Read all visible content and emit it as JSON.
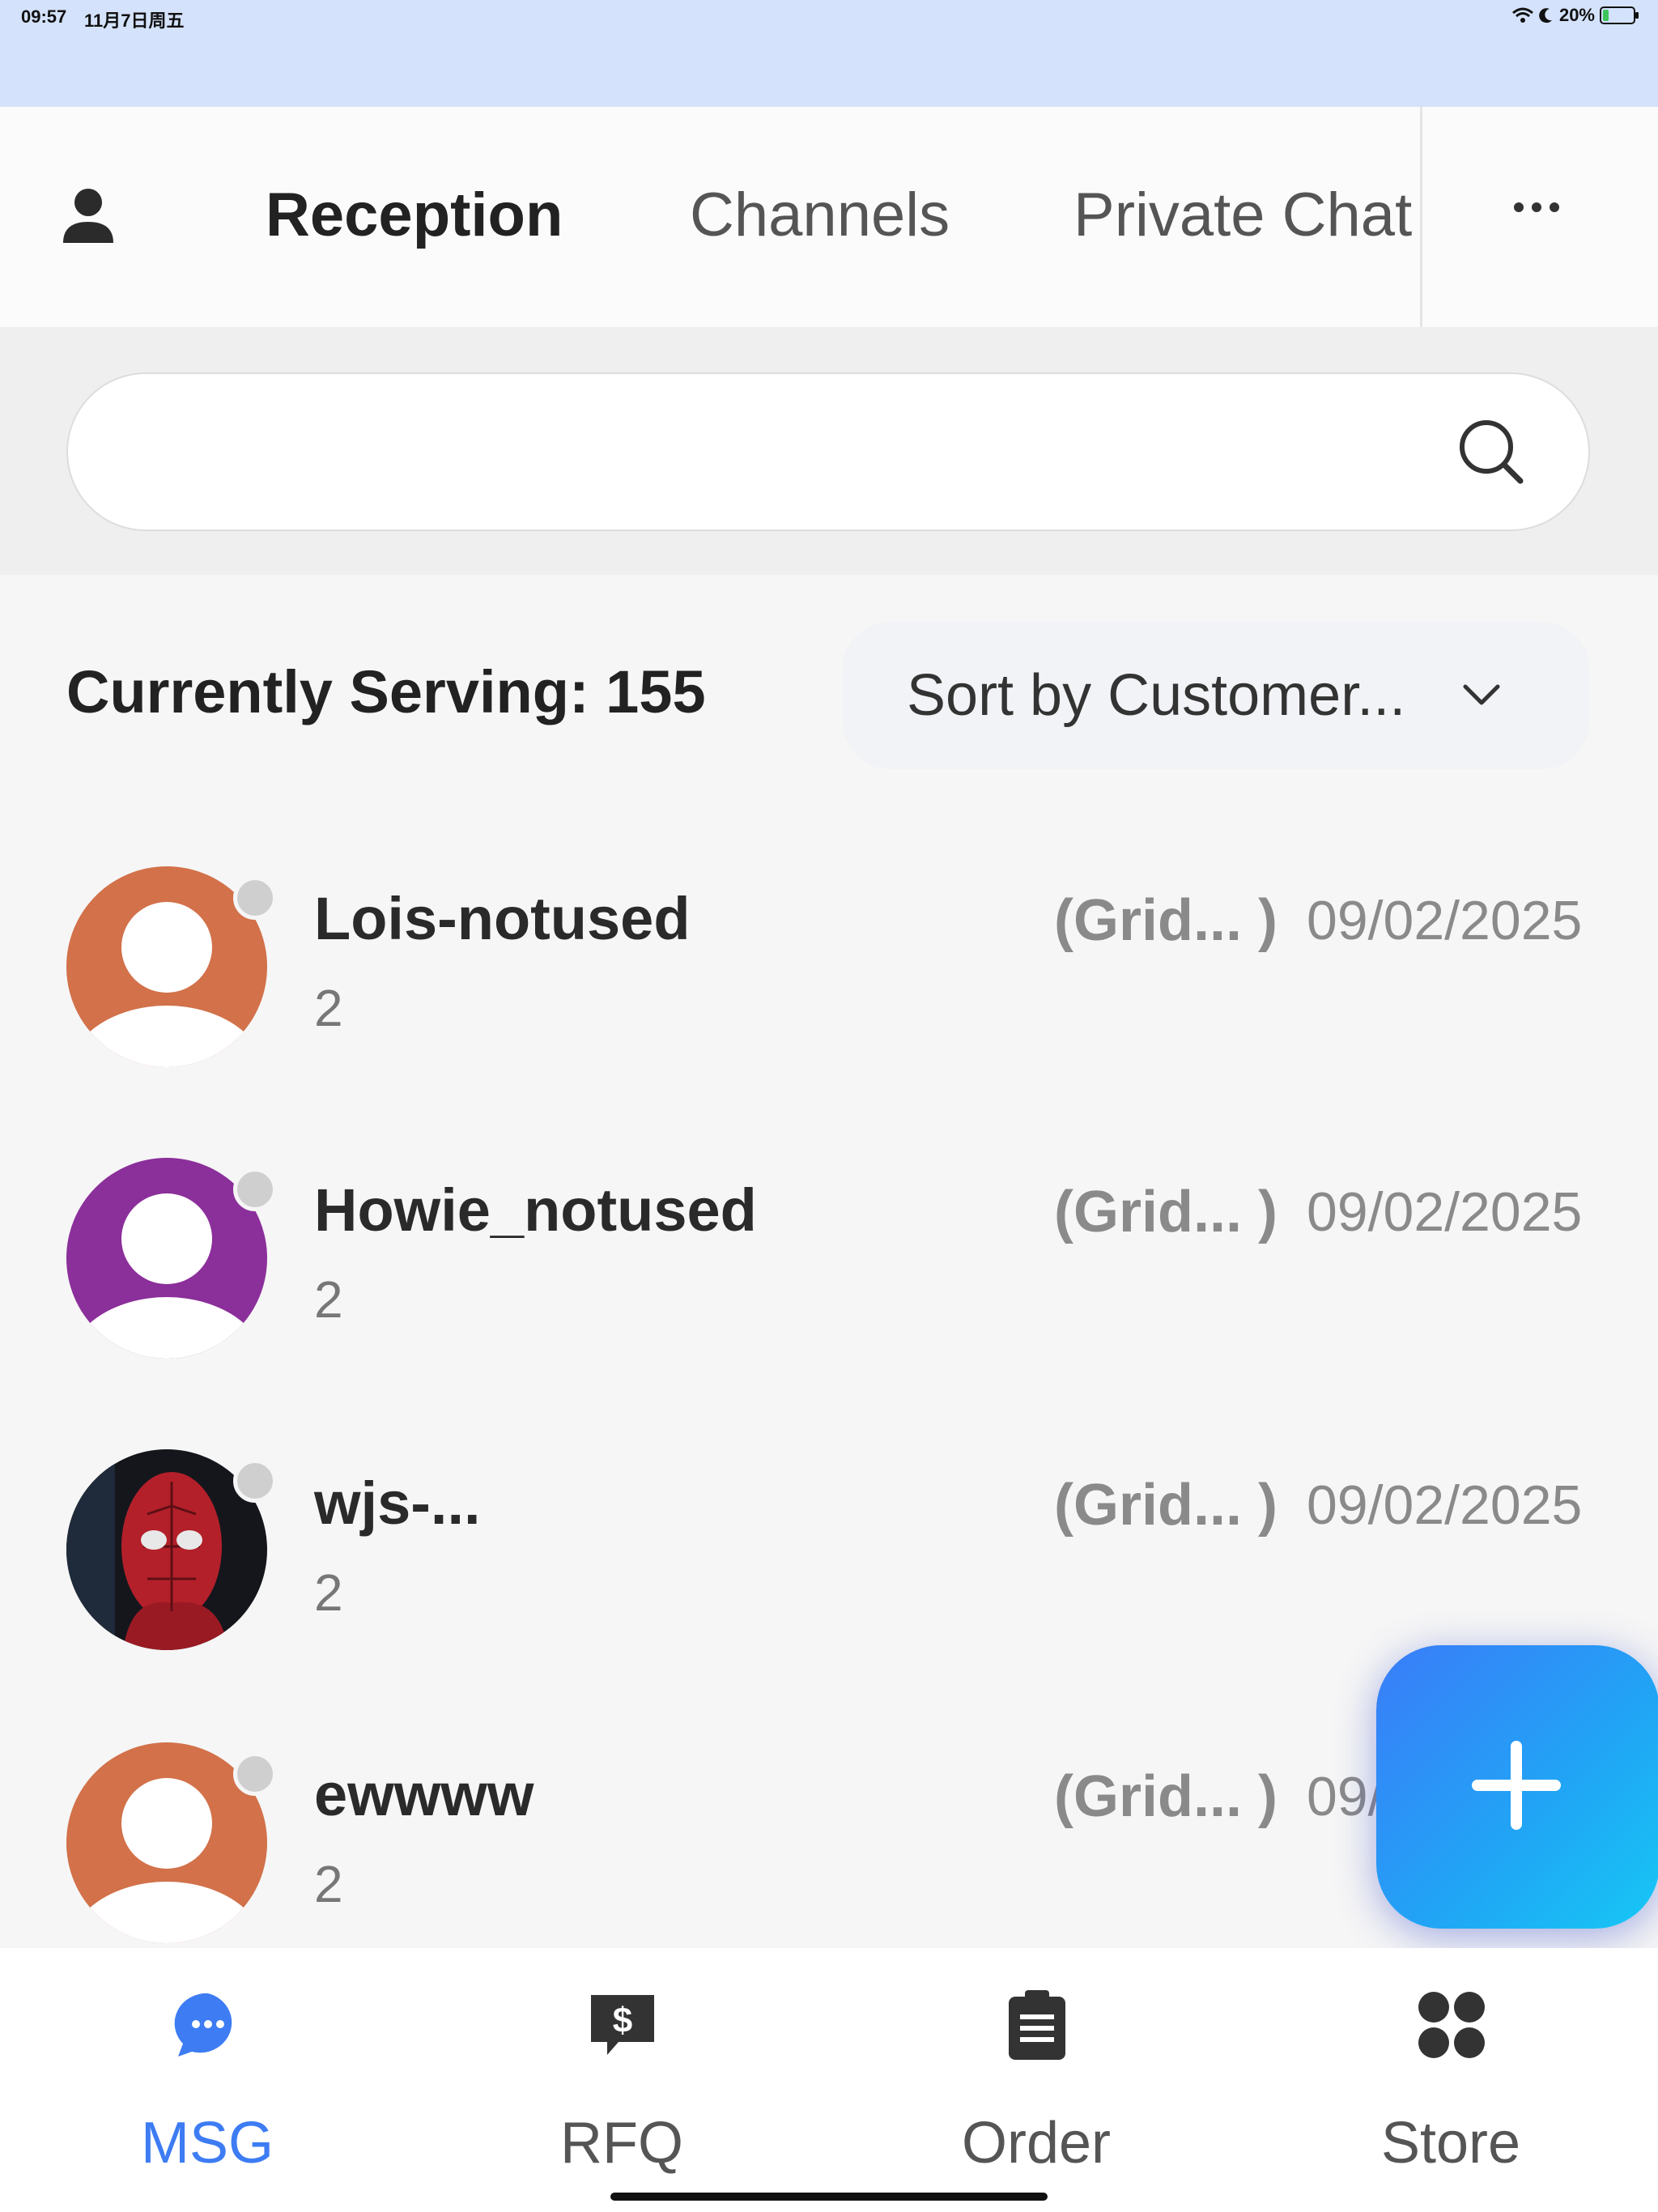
{
  "status_bar": {
    "time": "09:57",
    "date": "11月7日周五",
    "battery_text": "20%",
    "battery_level": 0.2,
    "icons": [
      "wifi-icon",
      "moon-icon",
      "battery-icon"
    ]
  },
  "top_nav": {
    "profile_icon": "person-icon",
    "tabs": [
      {
        "label": "Reception",
        "active": true
      },
      {
        "label": "Channels",
        "active": false
      },
      {
        "label": "Private Chat",
        "active": false
      }
    ],
    "more_icon": "more-dots-icon"
  },
  "search": {
    "value": "",
    "placeholder": "",
    "icon": "search-icon"
  },
  "queue": {
    "serving_text": "Currently Serving: 155",
    "sort_label": "Sort by Customer...",
    "sort_icon": "chevron-down-icon"
  },
  "conversations": [
    {
      "name": "Lois-notused",
      "count": "2",
      "group": "(Grid... )",
      "date": "09/02/2025",
      "avatar_color": "#d2714a",
      "avatar_type": "default",
      "status": "offline"
    },
    {
      "name": "Howie_notused",
      "count": "2",
      "group": "(Grid... )",
      "date": "09/02/2025",
      "avatar_color": "#8b2f9a",
      "avatar_type": "default",
      "status": "offline"
    },
    {
      "name": "wjs-...",
      "count": "2",
      "group": "(Grid... )",
      "date": "09/02/2025",
      "avatar_color": "#1a1a1a",
      "avatar_type": "photo",
      "status": "offline"
    },
    {
      "name": "ewwww",
      "count": "2",
      "group": "(Grid... )",
      "date": "09/",
      "avatar_color": "#d2714a",
      "avatar_type": "default",
      "status": "offline"
    }
  ],
  "fab": {
    "icon": "plus-icon",
    "colors": [
      "#3a7cf8",
      "#16c8f5"
    ]
  },
  "bottom_nav": [
    {
      "label": "MSG",
      "icon": "chat-bubble-icon",
      "active": true
    },
    {
      "label": "RFQ",
      "icon": "dollar-quote-icon",
      "active": false
    },
    {
      "label": "Order",
      "icon": "clipboard-icon",
      "active": false
    },
    {
      "label": "Store",
      "icon": "grid-clover-icon",
      "active": false
    }
  ],
  "colors": {
    "accent": "#3d7cf3",
    "status_bar_bg": "#d4e2fb",
    "page_bg": "#f6f6f6"
  }
}
